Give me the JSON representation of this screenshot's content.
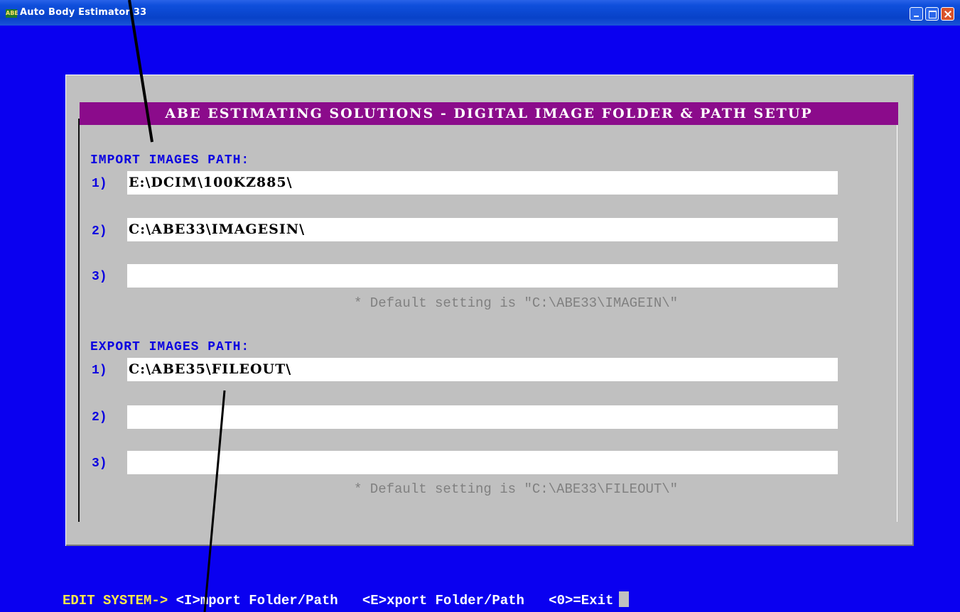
{
  "window": {
    "title": "Auto Body Estimator 33",
    "icon_text": "ABE"
  },
  "dialog": {
    "header": "ABE ESTIMATING SOLUTIONS - DIGITAL IMAGE FOLDER & PATH SETUP",
    "import": {
      "label": "IMPORT IMAGES PATH:",
      "rows": [
        {
          "num": "1)",
          "value": "E:\\DCIM\\100KZ885\\"
        },
        {
          "num": "2)",
          "value": "C:\\ABE33\\IMAGESIN\\"
        },
        {
          "num": "3)",
          "value": ""
        }
      ],
      "note": "* Default setting is \"C:\\ABE33\\IMAGEIN\\\""
    },
    "export": {
      "label": "EXPORT IMAGES PATH:",
      "rows": [
        {
          "num": "1)",
          "value": "C:\\ABE35\\FILEOUT\\"
        },
        {
          "num": "2)",
          "value": ""
        },
        {
          "num": "3)",
          "value": ""
        }
      ],
      "note": "* Default setting is \"C:\\ABE33\\FILEOUT\\\""
    }
  },
  "statusbar": {
    "lead": "EDIT SYSTEM->",
    "import_cmd": "<I>mport Folder/Path",
    "export_cmd": "<E>xport Folder/Path",
    "exit_cmd": "<0>=Exit"
  },
  "colors": {
    "background": "#0a00f0",
    "header_bar": "#8b0b8b",
    "label_blue": "#0a00e0",
    "status_yellow": "#ffe84a"
  }
}
